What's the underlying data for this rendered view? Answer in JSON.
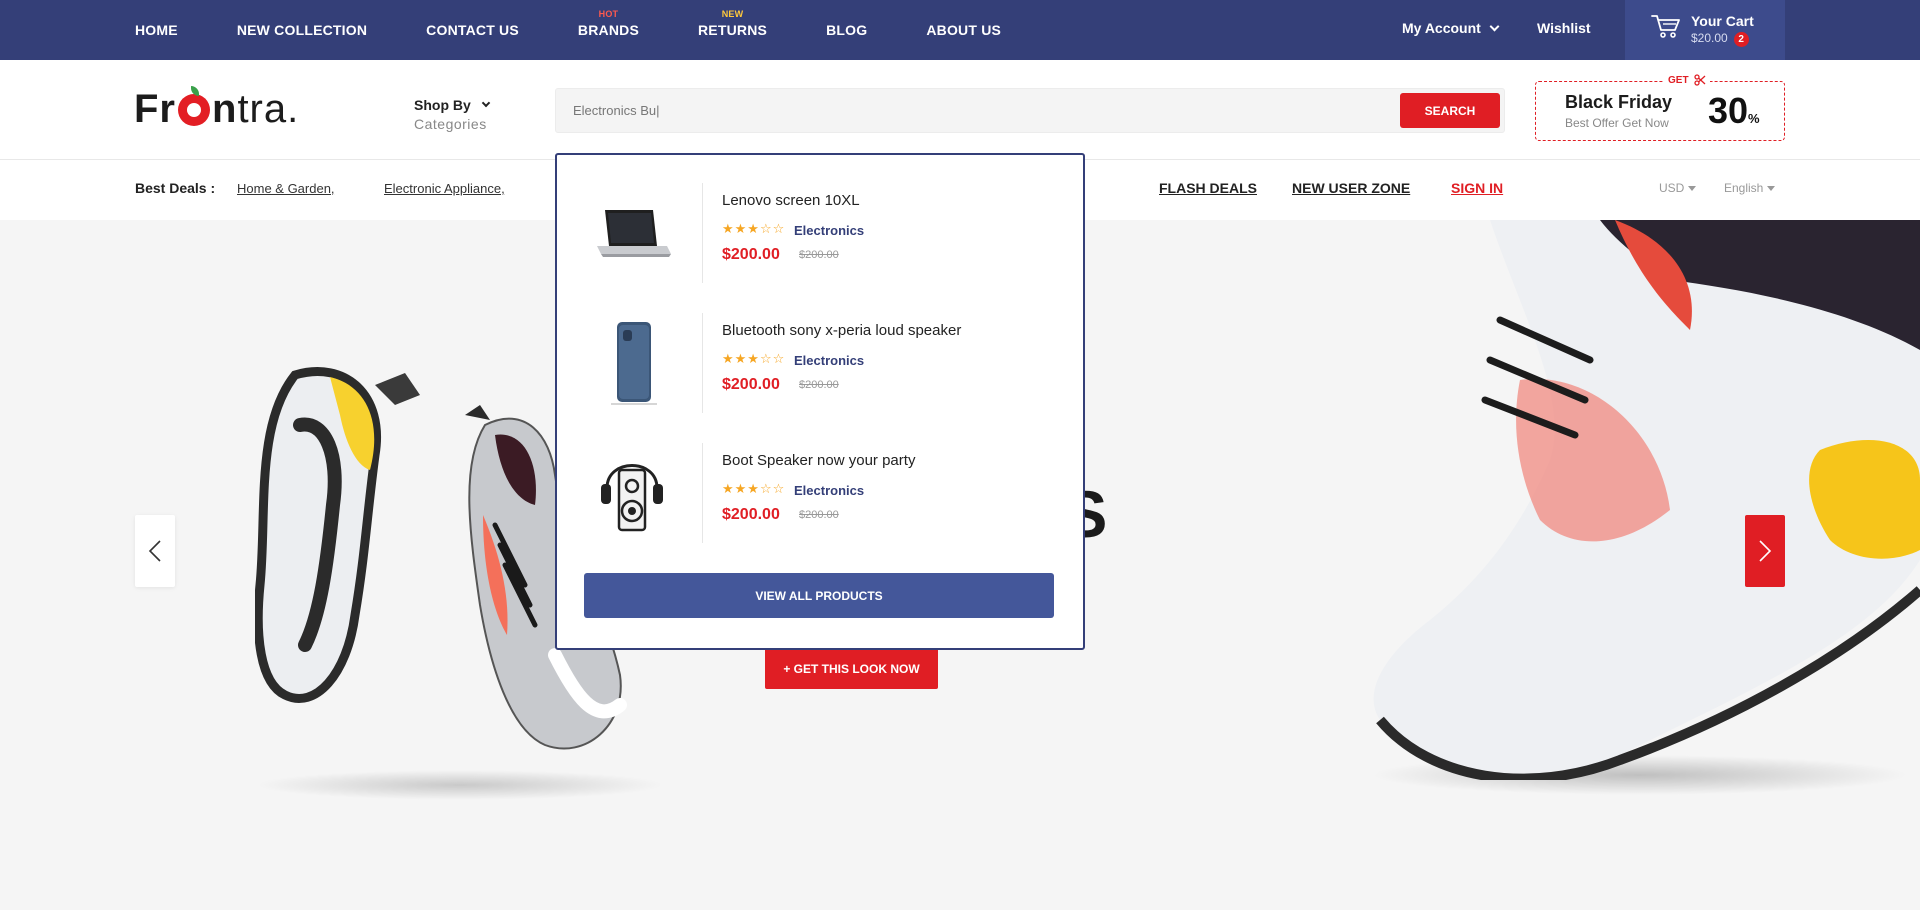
{
  "top_nav": {
    "items": [
      {
        "label": "HOME",
        "tag": ""
      },
      {
        "label": "NEW COLLECTION",
        "tag": ""
      },
      {
        "label": "CONTACT US",
        "tag": ""
      },
      {
        "label": "BRANDS",
        "tag": "HOT"
      },
      {
        "label": "RETURNS",
        "tag": "NEW"
      },
      {
        "label": "BLOG",
        "tag": ""
      },
      {
        "label": "ABOUT US",
        "tag": ""
      }
    ],
    "my_account": "My Account",
    "wishlist": "Wishlist",
    "cart": {
      "title": "Your Cart",
      "amount": "$20.00",
      "count": "2"
    }
  },
  "header": {
    "logo": {
      "bold_1": "Fr",
      "bold_2": "n",
      "light": "tra."
    },
    "shop_by": {
      "label": "Shop By",
      "sub": "Categories"
    },
    "search": {
      "value": "Electronics Bu|",
      "button": "SEARCH"
    },
    "promo": {
      "get": "GET",
      "title": "Black Friday",
      "subtitle": "Best Offer Get Now",
      "number": "30",
      "unit": "%"
    }
  },
  "deals_bar": {
    "label": "Best Deals :",
    "links": [
      "Home & Garden,",
      "Electronic Appliance,"
    ],
    "right_links": [
      "FLASH DEALS",
      "NEW USER ZONE",
      "SIGN IN"
    ],
    "currency": "USD",
    "language": "English"
  },
  "hero": {
    "headline_visible": "OES",
    "cta": "+ GET THIS LOOK NOW"
  },
  "search_results": {
    "items": [
      {
        "name": "Lenovo screen 10XL",
        "rating": 3,
        "stars": "★★★☆☆",
        "category": "Electronics",
        "price": "$200.00",
        "old_price": "$200.00",
        "thumb": "laptop-icon"
      },
      {
        "name": "Bluetooth sony x-peria loud speaker",
        "rating": 3,
        "stars": "★★★☆☆",
        "category": "Electronics",
        "price": "$200.00",
        "old_price": "$200.00",
        "thumb": "phone-icon"
      },
      {
        "name": "Boot Speaker now your party",
        "rating": 3,
        "stars": "★★★☆☆",
        "category": "Electronics",
        "price": "$200.00",
        "old_price": "$200.00",
        "thumb": "speaker-icon"
      }
    ],
    "view_all": "VIEW ALL PRODUCTS"
  },
  "colors": {
    "navy": "#343f78",
    "red": "#e01e24",
    "star": "#f6a623",
    "button_blue": "#44579a"
  }
}
